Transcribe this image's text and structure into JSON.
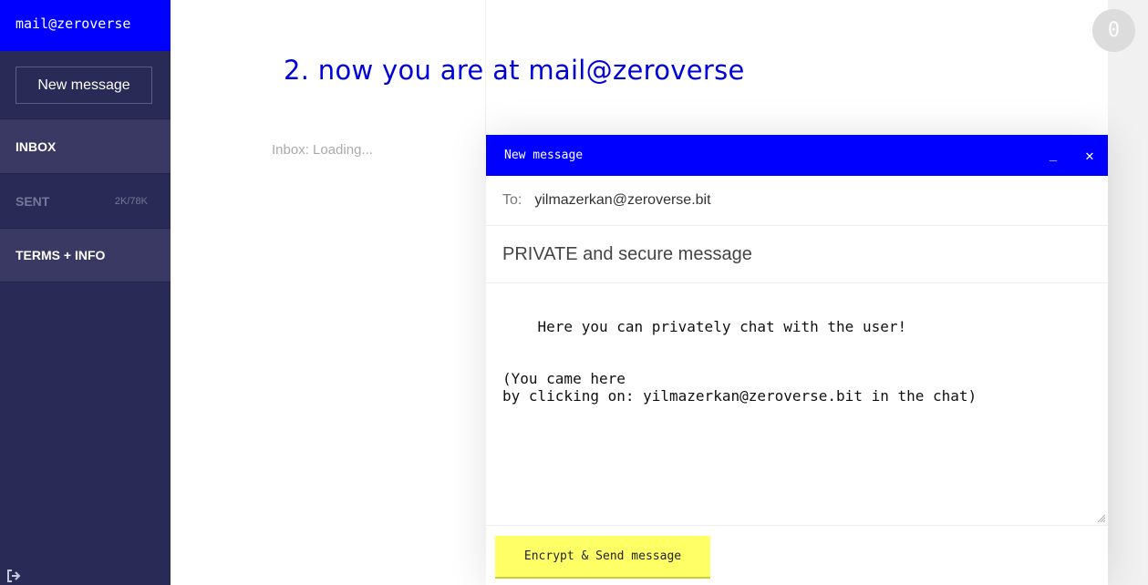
{
  "sidebar": {
    "account": "mail@zeroverse",
    "new_message_label": "New message",
    "nav": [
      {
        "label": "INBOX",
        "count": ""
      },
      {
        "label": "SENT",
        "count": "2K/78K"
      },
      {
        "label": "TERMS + INFO",
        "count": ""
      }
    ],
    "logout_icon": "logout-icon"
  },
  "main": {
    "headline": "2. now you are at mail@zeroverse",
    "inbox_status": "Inbox: Loading...",
    "counter": "0"
  },
  "compose": {
    "title": "New message",
    "minimize_label": "_",
    "close_label": "✕",
    "to_label": "To:",
    "to_value": "yilmazerkan@zeroverse.bit",
    "subject": "PRIVATE and secure message",
    "body": "Here you can privately chat with the user!\n\n\n(You came here\nby clicking on: yilmazerkan@zeroverse.bit in the chat)",
    "send_label": "Encrypt & Send message"
  },
  "colors": {
    "accent_blue": "#0000ff",
    "sidebar_bg": "#2a2a57",
    "headline": "#0000dd",
    "send_button": "#ffff66"
  }
}
